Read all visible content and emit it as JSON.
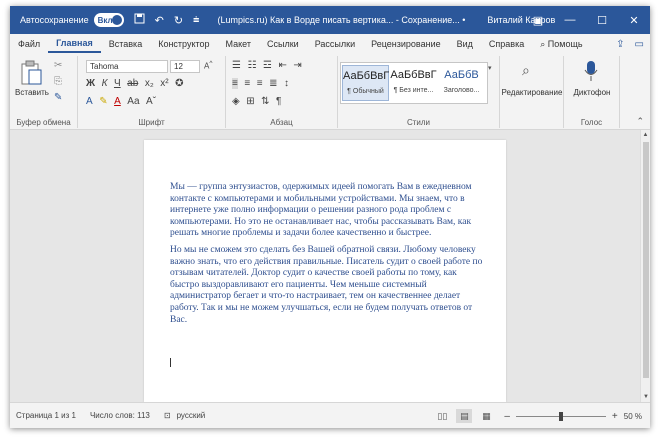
{
  "titlebar": {
    "autosave_label": "Автосохранение",
    "autosave_state": "Вкл",
    "doc_title": "(Lumpics.ru) Как в Ворде писать вертика... - Сохранение... •",
    "user": "Виталий Каиров",
    "icons": [
      "save-icon",
      "undo-icon",
      "redo-icon",
      "customize-icon"
    ]
  },
  "menu": {
    "tabs": [
      "Файл",
      "Главная",
      "Вставка",
      "Конструктор",
      "Макет",
      "Ссылки",
      "Рассылки",
      "Рецензирование",
      "Вид",
      "Справка"
    ],
    "active_tab": "Главная",
    "help_search": "Помощь"
  },
  "ribbon": {
    "clipboard": {
      "paste_label": "Вставить",
      "group_label": "Буфер обмена"
    },
    "font": {
      "font_name": "Tahoma",
      "font_size": "12",
      "group_label": "Шрифт"
    },
    "paragraph": {
      "group_label": "Абзац"
    },
    "styles": {
      "group_label": "Стили",
      "items": [
        {
          "sample": "АаБбВвГ",
          "name": "¶ Обычный"
        },
        {
          "sample": "АаБбВвГ",
          "name": "¶ Без инте..."
        },
        {
          "sample": "АаБбВ",
          "name": "Заголово..."
        }
      ]
    },
    "editing": {
      "label": "Редактирование"
    },
    "voice": {
      "label": "Диктофон",
      "group_label": "Голос"
    }
  },
  "document": {
    "paragraphs": [
      "Мы — группа энтузиастов, одержимых идеей помогать Вам в ежедневном контакте с компьютерами и мобильными устройствами. Мы знаем, что в интернете уже полно информации о решении разного рода проблем с компьютерами. Но это не останавливает нас, чтобы рассказывать Вам, как решать многие проблемы и задачи более качественно и быстрее.",
      "Но мы не сможем это сделать без Вашей обратной связи. Любому человеку важно знать, что его действия правильные. Писатель судит о своей работе по отзывам читателей. Доктор судит о качестве своей работы по тому, как быстро выздоравливают его пациенты. Чем меньше системный администратор бегает и что-то настраивает, тем он качественнее делает работу. Так и мы не можем улучшаться, если не будем получать ответов от Вас."
    ]
  },
  "statusbar": {
    "page": "Страница 1 из 1",
    "words": "Число слов: 113",
    "language": "русский",
    "zoom": "50 %",
    "zoom_minus": "–",
    "zoom_plus": "+"
  },
  "colors": {
    "accent": "#2b579a",
    "text": "#2f4f8f"
  }
}
